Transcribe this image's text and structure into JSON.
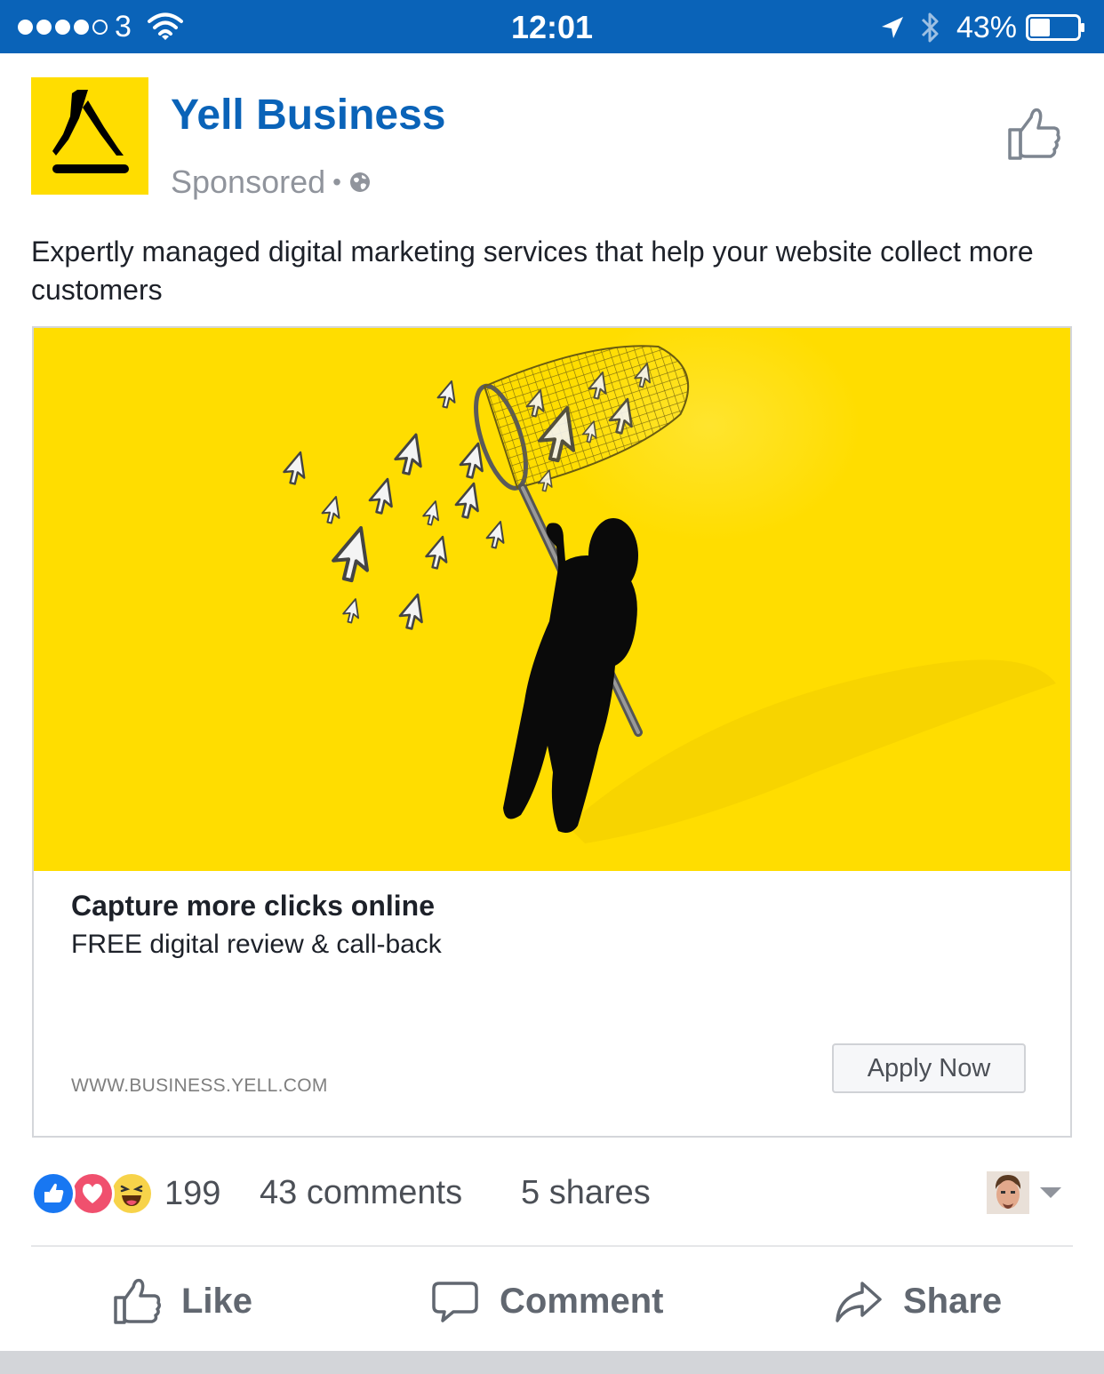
{
  "status_bar": {
    "carrier": "3",
    "time": "12:01",
    "battery": "43%",
    "battery_level": 0.43,
    "signal_bars_filled": 4,
    "signal_bars_total": 5
  },
  "post": {
    "page_name": "Yell Business",
    "sponsored_label": "Sponsored",
    "separator": "•",
    "audience_icon": "globe-icon",
    "text": "Expertly managed digital marketing services that help your website collect more customers"
  },
  "ad": {
    "headline": "Capture more clicks online",
    "description": "FREE digital review & call-back",
    "url": "WWW.BUSINESS.YELL.COM",
    "cta_label": "Apply Now"
  },
  "engagement": {
    "reactions_count": "199",
    "reaction_icons": [
      "like-reaction-icon",
      "love-reaction-icon",
      "haha-reaction-icon"
    ],
    "comments": "43 comments",
    "shares": "5 shares"
  },
  "actions": {
    "like": "Like",
    "comment": "Comment",
    "share": "Share"
  },
  "colors": {
    "status_bar": "#0a63b8",
    "brand_blue": "#0a63b8",
    "yell_yellow": "#ffdd00",
    "muted_text": "#90949c",
    "action_text": "#616770"
  }
}
